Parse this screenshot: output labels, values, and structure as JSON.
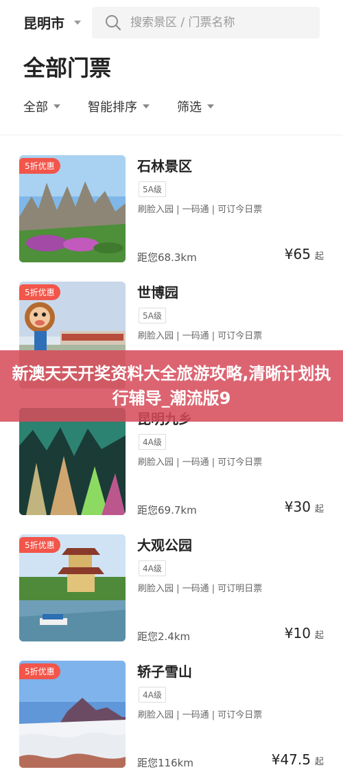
{
  "header": {
    "city": "昆明市",
    "search_placeholder": "搜索景区 / 门票名称"
  },
  "page_title": "全部门票",
  "filters": [
    {
      "label": "全部"
    },
    {
      "label": "智能排序"
    },
    {
      "label": "筛选"
    }
  ],
  "items": [
    {
      "name": "石林景区",
      "badge": "5折优惠",
      "level": "5A级",
      "features": "刷脸入园 | 一码通 | 可订今日票",
      "distance": "距您68.3km",
      "price": "¥65",
      "price_suffix": "起",
      "theme": "stone"
    },
    {
      "name": "世博园",
      "badge": "5折优惠",
      "level": "5A级",
      "features": "刷脸入园 | 一码通 | 可订今日票",
      "distance": "",
      "price": "",
      "price_suffix": "",
      "theme": "expo"
    },
    {
      "name": "昆明九乡",
      "badge": "",
      "level": "4A级",
      "features": "刷脸入园 | 一码通 | 可订今日票",
      "distance": "距您69.7km",
      "price": "¥30",
      "price_suffix": "起",
      "theme": "cave"
    },
    {
      "name": "大观公园",
      "badge": "5折优惠",
      "level": "4A级",
      "features": "刷脸入园 | 一码通 | 可订明日票",
      "distance": "距您2.4km",
      "price": "¥10",
      "price_suffix": "起",
      "theme": "park"
    },
    {
      "name": "轿子雪山",
      "badge": "5折优惠",
      "level": "4A级",
      "features": "刷脸入园 | 一码通 | 可订今日票",
      "distance": "距您116km",
      "price": "¥47.5",
      "price_suffix": "起",
      "theme": "snow"
    }
  ],
  "overlay_banner": "新澳天天开奖资料大全旅游攻略,清晰计划执行辅导_潮流版9",
  "colors": {
    "badge": "#f2554a",
    "overlay": "#d64a5a"
  },
  "icons": {
    "search": "search-icon",
    "dropdown": "chevron-down-icon"
  }
}
